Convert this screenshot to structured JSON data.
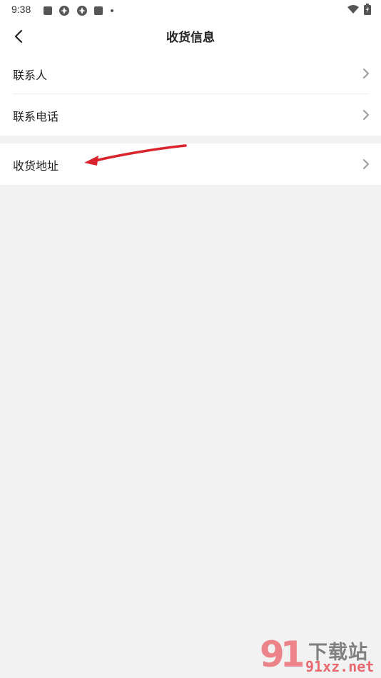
{
  "status_bar": {
    "time": "9:38",
    "icons": [
      "square-icon",
      "pinwheel-icon",
      "pinwheel-icon",
      "square-icon",
      "dot-icon"
    ],
    "right_icons": [
      "wifi-icon",
      "battery-charging-icon"
    ]
  },
  "header": {
    "title": "收货信息",
    "back_icon": "chevron-left-icon"
  },
  "sections": [
    {
      "items": [
        {
          "label": "联系人"
        },
        {
          "label": "联系电话"
        }
      ]
    },
    {
      "items": [
        {
          "label": "收货地址"
        }
      ]
    }
  ],
  "annotation": {
    "type": "arrow",
    "color": "#d9232d",
    "points_to": "收货地址"
  },
  "watermark": {
    "logo_text": "91",
    "title": "下载站",
    "url": "91xz.net"
  },
  "colors": {
    "background": "#f2f2f2",
    "surface": "#ffffff",
    "text": "#222222",
    "chevron": "#9a9a9a",
    "arrow": "#d9232d"
  }
}
